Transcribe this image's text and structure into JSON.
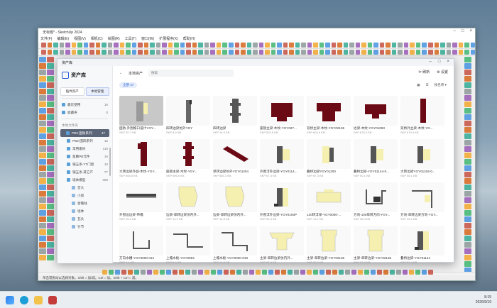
{
  "app": {
    "title": "无标题* - SketchUp 2024",
    "menus": [
      "文件(F)",
      "编辑(E)",
      "视图(V)",
      "相机(C)",
      "绘图(R)",
      "工具(T)",
      "窗口(W)",
      "扩展程序(X)",
      "帮助(H)"
    ]
  },
  "status": "单击或拖动以选择对象。Shift = 加/减。Ctrl = 加。Shift + Ctrl = 减。",
  "clock": {
    "time": "8:15",
    "date": "2026/9/19"
  },
  "dialog": {
    "title": "资产库",
    "heading": "资产库",
    "tabs": [
      "插件资产",
      "本地管理"
    ],
    "quick": [
      {
        "label": "最近使用",
        "count": "19"
      },
      {
        "label": "收藏夹",
        "count": "0"
      }
    ],
    "section": "本地文件夹",
    "folders": [
      {
        "label": "PB3-国防系列",
        "count": "47",
        "level": 0,
        "selected": true
      },
      {
        "label": "PB3-国风系列",
        "count": "15",
        "level": 1
      },
      {
        "label": "常用素材",
        "count": "110",
        "level": 1
      },
      {
        "label": "鱼鳞PB元件",
        "count": "16",
        "level": 1
      },
      {
        "label": "铺五条-YT门窗",
        "count": "10",
        "level": 1
      },
      {
        "label": "铺五条-其它产",
        "count": "77",
        "level": 1
      },
      {
        "label": "墙体模型",
        "count": "305",
        "level": 1
      },
      {
        "label": "宫大",
        "count": "",
        "level": 2
      },
      {
        "label": "小窗",
        "count": "",
        "level": 2
      },
      {
        "label": "窗檐柱",
        "count": "",
        "level": 2
      },
      {
        "label": "墙体",
        "count": "",
        "level": 2
      },
      {
        "label": "瓦头",
        "count": "",
        "level": 2
      },
      {
        "label": "竹节",
        "count": "",
        "level": 2
      }
    ],
    "nav": {
      "back": "←",
      "path": "本地资产",
      "search_placeholder": "搜索",
      "refresh": "刷新",
      "settings": "设置"
    },
    "filter": {
      "chip": "全部",
      "count": "47",
      "sort": "按名称 ▾"
    },
    "items": [
      {
        "name": "国防-外围檐口设计YGY...",
        "meta": "SKP  20.7 KB",
        "shape": "l",
        "color": "#9a9a9a",
        "selected": true
      },
      {
        "name": "四转边梁仿外YGY",
        "meta": "SKP  8.9 KB",
        "shape": "bar",
        "color": "#666"
      },
      {
        "name": "四转边梁",
        "meta": "SKP  16.5 KB",
        "shape": "col",
        "color": "#555"
      },
      {
        "name": "座锁主梁-木纹-YGY027...",
        "meta": "SKP  502.5 KB",
        "shape": "wide",
        "color": "#6b0a14"
      },
      {
        "name": "双桥主梁-木纹-YGY02136",
        "meta": "SKP  604.6 KB",
        "shape": "wide2",
        "color": "#6b0a14"
      },
      {
        "name": "达梁-木纹-YGY01093",
        "meta": "SKP  675.0 KB",
        "shape": "wide3",
        "color": "#6b0a14"
      },
      {
        "name": "双桥外主梁-木纹-YG...",
        "meta": "SKP  670.4 KB",
        "shape": "slim",
        "color": "#6b0a14"
      },
      {
        "name": "大转边梁外副-木纹-YGY...",
        "meta": "SKP  606.5 KB",
        "shape": "slimr",
        "color": "#6b0a14"
      },
      {
        "name": "座锁主梁-木纹-YGY...",
        "meta": "SKP  696.0 KB",
        "shape": "col",
        "color": "#6b0a14"
      },
      {
        "name": "单转边梁仿外YGY01204",
        "meta": "SKP  585.1 KB",
        "shape": "diag",
        "color": "#6b0a14"
      },
      {
        "name": "外围浮外边梁-YGY0114...",
        "meta": "SKP  67.3 KB",
        "shape": "step",
        "color": "#555"
      },
      {
        "name": "叠桥边梁YGY01200",
        "meta": "SKP  67.3 KB",
        "shape": "step2",
        "color": "#555"
      },
      {
        "name": "叠桥边梁-YGY01144-0...",
        "meta": "SKP  50.1 KB",
        "shape": "step",
        "color": "#555"
      },
      {
        "name": "大转边梁YGY01204-0...",
        "meta": "SKP  58.1 KB",
        "shape": "step",
        "color": "#555"
      },
      {
        "name": "外围边边梁-带檐",
        "meta": "SKP  28.6 KB",
        "shape": "flat",
        "color": "#444"
      },
      {
        "name": "边梁-单转边梁仿内外...",
        "meta": "SKP  14.9 KB",
        "shape": "cream",
        "color": "#f5efb0"
      },
      {
        "name": "边梁-单转边梁仿内外...",
        "meta": "SKP  14.8 KB",
        "shape": "cream",
        "color": "#f5efb0"
      },
      {
        "name": "外围浮外边梁-YGY0193P",
        "meta": "SKP  53.3 KB",
        "shape": "step3",
        "color": "#555"
      },
      {
        "name": "120转浮梁-YGY0000-...",
        "meta": "SKP  11.2 KB",
        "shape": "cream2",
        "color": "#f5efb0"
      },
      {
        "name": "方向-100单转方向-YGY...",
        "meta": "SKP  38.4 KB",
        "shape": "zig",
        "color": "#555"
      },
      {
        "name": "方向-单转边梁方向-YGY...",
        "meta": "SKP  25.2 KB",
        "shape": "zig2",
        "color": "#555"
      },
      {
        "name": "方向水槽-YGY0000-012",
        "meta": "SKP  7.1 KB",
        "shape": "u",
        "color": "#555"
      },
      {
        "name": "上檐水板-YGY0654",
        "meta": "SKP  8.6 KB",
        "shape": "z",
        "color": "#555"
      },
      {
        "name": "上檐水板-YGY0000-019",
        "meta": "SKP  14.8 KB",
        "shape": "z2",
        "color": "#555"
      },
      {
        "name": "主梁-单转边梁仿内外...",
        "meta": "SKP  87.0 KB",
        "shape": "cream3",
        "color": "#f5efb0"
      },
      {
        "name": "主梁-单转边梁-YGY02136",
        "meta": "SKP  87.0 KB",
        "shape": "cream4",
        "color": "#f5efb0"
      },
      {
        "name": "主梁-单转边梁-YGY02136",
        "meta": "SKP  87.0 KB",
        "shape": "cream4",
        "color": "#f5efb0"
      },
      {
        "name": "叠桥边梁-YGY01144",
        "meta": "SKP  57.4 KB",
        "shape": "step3",
        "color": "#555"
      }
    ]
  }
}
